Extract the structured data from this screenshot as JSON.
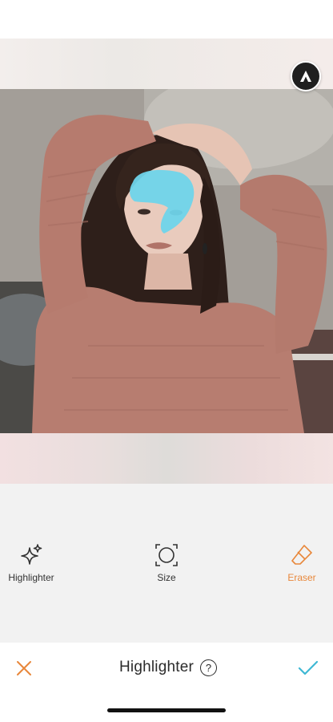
{
  "editor": {
    "brand_logo_icon": "airbrush-logo-icon",
    "tools": [
      {
        "label": "Highlighter",
        "icon": "sparkle-icon",
        "active": false
      },
      {
        "label": "Size",
        "icon": "brush-size-icon",
        "active": false
      },
      {
        "label": "Eraser",
        "icon": "eraser-icon",
        "active": true
      }
    ],
    "title": "Highlighter",
    "help_icon_glyph": "?",
    "cancel_icon": "close-icon",
    "confirm_icon": "checkmark-icon",
    "colors": {
      "accent": "#e8873a",
      "confirm": "#3fb8d4",
      "highlight_mask": "#6fd4ea"
    }
  }
}
